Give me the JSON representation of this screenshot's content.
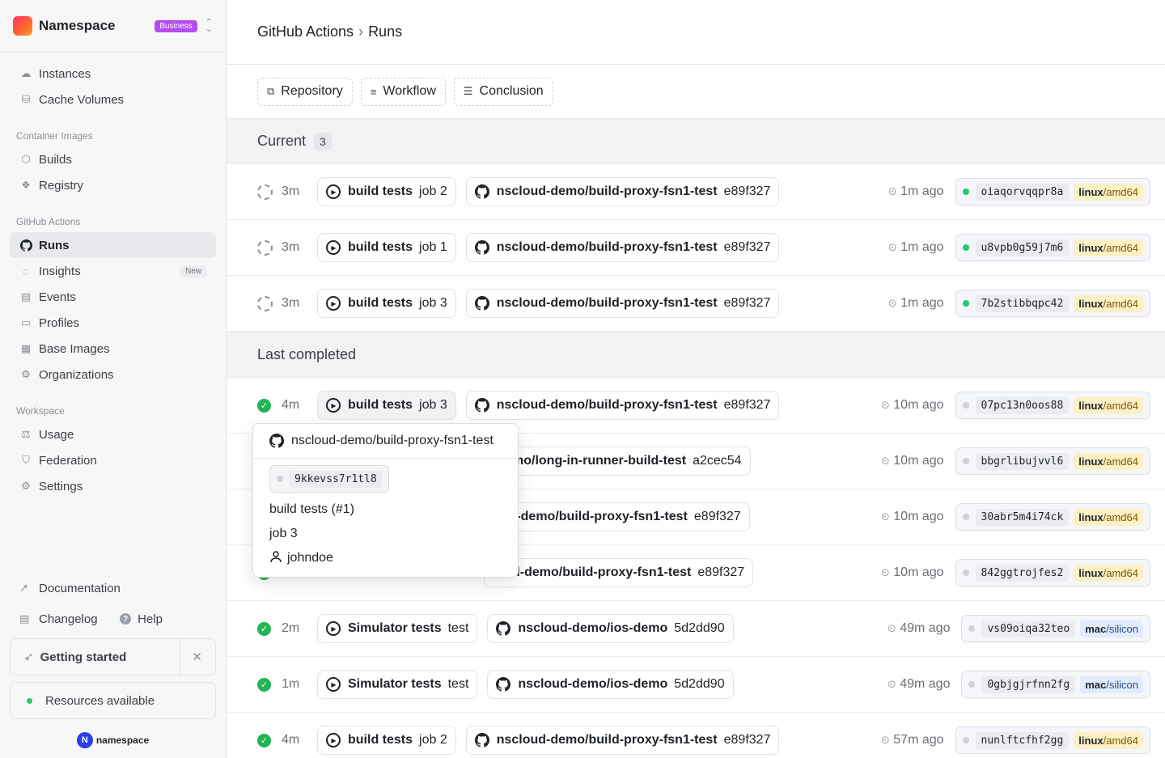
{
  "brand": {
    "name": "Namespace",
    "plan": "Business"
  },
  "sidebar": {
    "top_items": [
      {
        "label": "Instances",
        "icon": "cloud-icon"
      },
      {
        "label": "Cache Volumes",
        "icon": "database-icon"
      }
    ],
    "sections": [
      {
        "label": "Container Images",
        "items": [
          {
            "label": "Builds",
            "icon": "package-icon"
          },
          {
            "label": "Registry",
            "icon": "boxes-icon"
          }
        ]
      },
      {
        "label": "GitHub Actions",
        "items": [
          {
            "label": "Runs",
            "icon": "github-icon",
            "active": true
          },
          {
            "label": "Insights",
            "icon": "lightbulb-icon",
            "badge": "New"
          },
          {
            "label": "Events",
            "icon": "list-icon"
          },
          {
            "label": "Profiles",
            "icon": "folder-icon"
          },
          {
            "label": "Base Images",
            "icon": "calendar-icon"
          },
          {
            "label": "Organizations",
            "icon": "gear-icon"
          }
        ]
      },
      {
        "label": "Workspace",
        "items": [
          {
            "label": "Usage",
            "icon": "scale-icon"
          },
          {
            "label": "Federation",
            "icon": "shield-icon"
          },
          {
            "label": "Settings",
            "icon": "gear-icon"
          }
        ]
      }
    ],
    "documentation": "Documentation",
    "changelog": "Changelog",
    "help": "Help",
    "getting_started": "Getting started",
    "resources": "Resources available",
    "footer_brand": "namespace"
  },
  "header": {
    "parent": "GitHub Actions",
    "current": "Runs"
  },
  "filters": [
    "Repository",
    "Workflow",
    "Conclusion"
  ],
  "groups": [
    {
      "title": "Current",
      "count": "3",
      "rows": [
        {
          "state": "running",
          "dur": "3m",
          "job_name": "build tests",
          "job": "job 2",
          "repo": "nscloud-demo/build-proxy-fsn1-test",
          "sha": "e89f327",
          "ago": "1m ago",
          "instance": "oiaqorvqqpr8a",
          "online": true,
          "os": "linux",
          "arch": "amd64"
        },
        {
          "state": "running",
          "dur": "3m",
          "job_name": "build tests",
          "job": "job 1",
          "repo": "nscloud-demo/build-proxy-fsn1-test",
          "sha": "e89f327",
          "ago": "1m ago",
          "instance": "u8vpb0g59j7m6",
          "online": true,
          "os": "linux",
          "arch": "amd64"
        },
        {
          "state": "running",
          "dur": "3m",
          "job_name": "build tests",
          "job": "job 3",
          "repo": "nscloud-demo/build-proxy-fsn1-test",
          "sha": "e89f327",
          "ago": "1m ago",
          "instance": "7b2stibbqpc42",
          "online": true,
          "os": "linux",
          "arch": "amd64"
        }
      ]
    },
    {
      "title": "Last completed",
      "count": "",
      "rows": [
        {
          "state": "success",
          "dur": "4m",
          "job_name": "build tests",
          "job": "job 3",
          "repo": "nscloud-demo/build-proxy-fsn1-test",
          "sha": "e89f327",
          "ago": "10m ago",
          "instance": "07pc13n0oos88",
          "online": false,
          "os": "linux",
          "arch": "amd64",
          "highlight": true
        },
        {
          "state": "success",
          "dur": "",
          "job_name": "",
          "job": "",
          "repo": "-demo/long-in-runner-build-test",
          "sha": "a2cec54",
          "ago": "10m ago",
          "instance": "bbgrlibujvvl6",
          "online": false,
          "os": "linux",
          "arch": "amd64"
        },
        {
          "state": "success",
          "dur": "",
          "job_name": "",
          "job": "",
          "repo": "oud-demo/build-proxy-fsn1-test",
          "sha": "e89f327",
          "ago": "10m ago",
          "instance": "30abr5m4i74ck",
          "online": false,
          "os": "linux",
          "arch": "amd64"
        },
        {
          "state": "success",
          "dur": "",
          "job_name": "",
          "job": "",
          "repo": "loud-demo/build-proxy-fsn1-test",
          "sha": "e89f327",
          "ago": "10m ago",
          "instance": "842ggtrojfes2",
          "online": false,
          "os": "linux",
          "arch": "amd64"
        },
        {
          "state": "success",
          "dur": "2m",
          "job_name": "Simulator tests",
          "job": "test",
          "repo": "nscloud-demo/ios-demo",
          "sha": "5d2dd90",
          "ago": "49m ago",
          "instance": "vs09oiqa32teo",
          "online": false,
          "os": "mac",
          "arch": "silicon"
        },
        {
          "state": "success",
          "dur": "1m",
          "job_name": "Simulator tests",
          "job": "test",
          "repo": "nscloud-demo/ios-demo",
          "sha": "5d2dd90",
          "ago": "49m ago",
          "instance": "0gbjgjrfnn2fg",
          "online": false,
          "os": "mac",
          "arch": "silicon"
        },
        {
          "state": "success",
          "dur": "4m",
          "job_name": "build tests",
          "job": "job 2",
          "repo": "nscloud-demo/build-proxy-fsn1-test",
          "sha": "e89f327",
          "ago": "57m ago",
          "instance": "nunlftcfhf2gg",
          "online": false,
          "os": "linux",
          "arch": "amd64"
        }
      ]
    }
  ],
  "popover": {
    "repo": "nscloud-demo/build-proxy-fsn1-test",
    "instance": "9kkevss7r1tl8",
    "workflow": "build tests (#1)",
    "job": "job 3",
    "user": "johndoe"
  },
  "colors": {
    "success": "#22b455",
    "online": "#28c76f",
    "linux_chip": "#fdf0c7",
    "mac_chip": "#e2ebfb",
    "plan_badge": "#b54cf0"
  }
}
